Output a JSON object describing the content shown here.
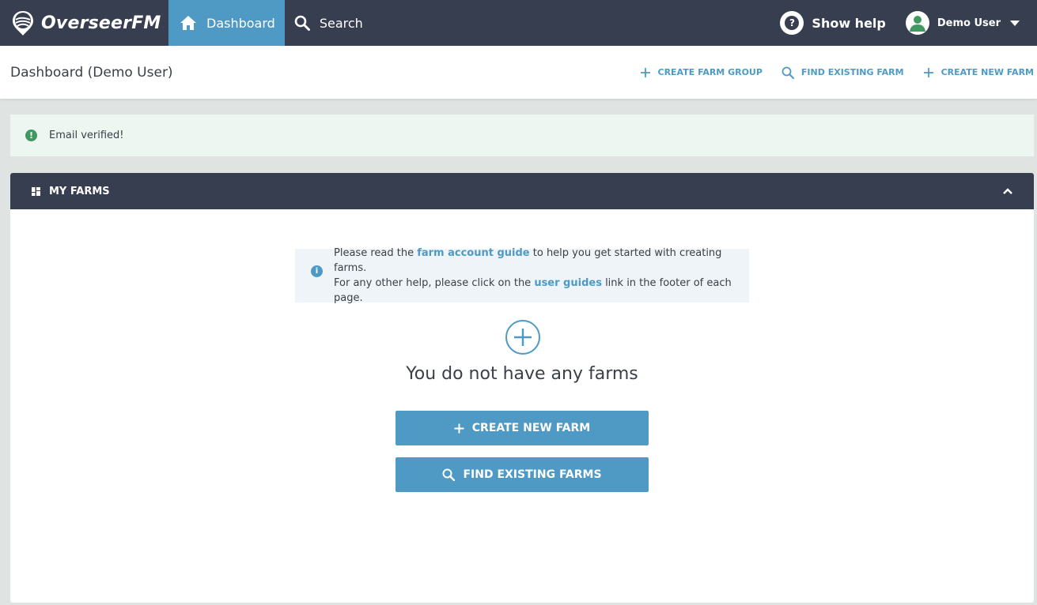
{
  "app": {
    "name": "OverseerFM"
  },
  "nav": {
    "items": [
      {
        "label": "Dashboard",
        "icon": "home-icon",
        "active": true
      },
      {
        "label": "Search",
        "icon": "search-icon",
        "active": false
      }
    ],
    "help_label": "Show help",
    "user_name": "Demo User"
  },
  "subheader": {
    "title": "Dashboard (Demo User)",
    "actions": [
      {
        "label": "CREATE FARM GROUP",
        "icon": "plus-icon"
      },
      {
        "label": "FIND EXISTING FARM",
        "icon": "search-icon"
      },
      {
        "label": "CREATE NEW FARM",
        "icon": "plus-icon"
      }
    ]
  },
  "alert": {
    "text": "Email verified!"
  },
  "panel": {
    "title": "MY FARMS",
    "info": {
      "line1_pre": "Please read the ",
      "line1_link": "farm account guide",
      "line1_post": " to help you get started with creating farms.",
      "line2_pre": "For any other help, please click on the ",
      "line2_link": "user guides",
      "line2_post": " link in the footer of each page."
    },
    "empty_text": "You do not have any farms",
    "create_button": "CREATE NEW FARM",
    "find_button": "FIND EXISTING FARMS"
  },
  "colors": {
    "topbar": "#373e50",
    "accent": "#4e9ac5",
    "success": "#3f9960",
    "alert_bg": "#edf6f1",
    "info_bg": "#eef4f7"
  }
}
